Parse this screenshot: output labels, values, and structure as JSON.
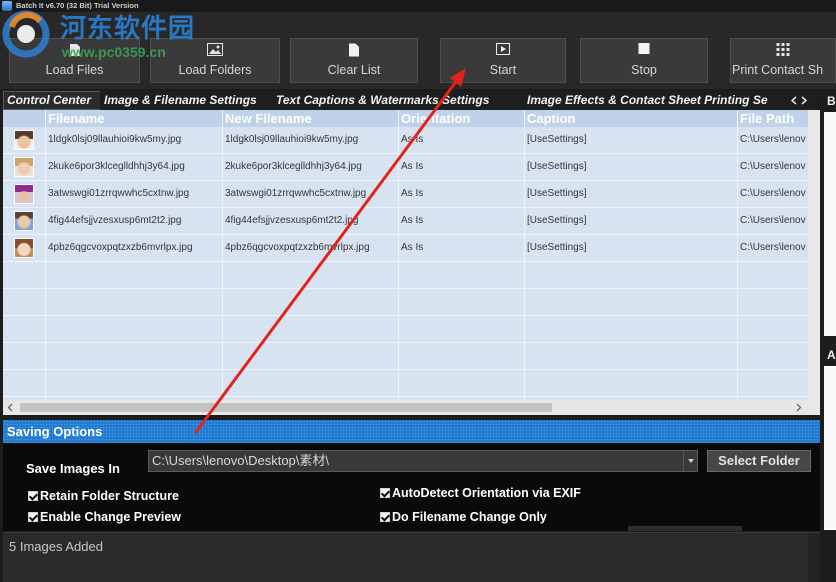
{
  "window": {
    "title": "Batch It v6.70 (32 Bit) Trial Version"
  },
  "watermark": {
    "site_name": "河东软件园",
    "site_url": "www.pc0359.cn"
  },
  "toolbar": {
    "load_files": {
      "label": "Load Files",
      "icon": "file-icon"
    },
    "load_folders": {
      "label": "Load Folders",
      "icon": "image-icon"
    },
    "clear_list": {
      "label": "Clear List",
      "icon": "document-icon"
    },
    "start": {
      "label": "Start",
      "icon": "play-icon"
    },
    "stop": {
      "label": "Stop",
      "icon": "stop-icon"
    },
    "print_contact_sheet": {
      "label": "Print Contact Sh",
      "icon": "contact-sheet-icon"
    }
  },
  "tabs": [
    {
      "label": "Control Center",
      "selected": true
    },
    {
      "label": "Image & Filename Settings",
      "selected": false
    },
    {
      "label": "Text Captions & Watermarks Settings",
      "selected": false
    },
    {
      "label": "Image Effects & Contact Sheet Printing Se",
      "selected": false
    }
  ],
  "side_panels": {
    "upper_label": "B",
    "lower_label": "A"
  },
  "file_grid": {
    "columns": {
      "filename": "Filename",
      "new_filename": "New Filename",
      "orientation": "Orientation",
      "caption": "Caption",
      "file_path": "File Path"
    },
    "rows": [
      {
        "filename": "1ldgk0lsj09llauhioi9kw5my.jpg",
        "new_filename": "1ldgk0lsj09llauhioi9kw5my.jpg",
        "orientation": "As Is",
        "caption": "[UseSettings]",
        "file_path": "C:\\Users\\lenov"
      },
      {
        "filename": "2kuke6por3klceglldhhj3y64.jpg",
        "new_filename": "2kuke6por3klceglldhhj3y64.jpg",
        "orientation": "As Is",
        "caption": "[UseSettings]",
        "file_path": "C:\\Users\\lenov"
      },
      {
        "filename": "3atwswgi01zrrqwwhc5cxtnw.jpg",
        "new_filename": "3atwswgi01zrrqwwhc5cxtnw.jpg",
        "orientation": "As Is",
        "caption": "[UseSettings]",
        "file_path": "C:\\Users\\lenov"
      },
      {
        "filename": "4fig44efsjjvzesxusp6mt2t2.jpg",
        "new_filename": "4fig44efsjjvzesxusp6mt2t2.jpg",
        "orientation": "As Is",
        "caption": "[UseSettings]",
        "file_path": "C:\\Users\\lenov"
      },
      {
        "filename": "4pbz6qgcvoxpqtzxzb6mvrlpx.jpg",
        "new_filename": "4pbz6qgcvoxpqtzxzb6mvrlpx.jpg",
        "orientation": "As Is",
        "caption": "[UseSettings]",
        "file_path": "C:\\Users\\lenov"
      }
    ]
  },
  "saving_options": {
    "title": "Saving Options",
    "save_in_label": "Save Images In",
    "save_in_path": "C:\\Users\\lenovo\\Desktop\\素材\\",
    "select_folder_label": "Select Folder",
    "checkboxes": [
      {
        "label": "Retain Folder Structure",
        "checked": true
      },
      {
        "label": "Enable Change Preview",
        "checked": true
      },
      {
        "label": "AutoDetect Orientation via EXIF",
        "checked": true
      },
      {
        "label": "Do Filename Change Only",
        "checked": true
      }
    ]
  },
  "status": {
    "message": "5 Images Added"
  },
  "colors": {
    "accent": "#1b78d0",
    "annotation_arrow": "#e0241b",
    "grid_background": "#d8e3f1"
  }
}
